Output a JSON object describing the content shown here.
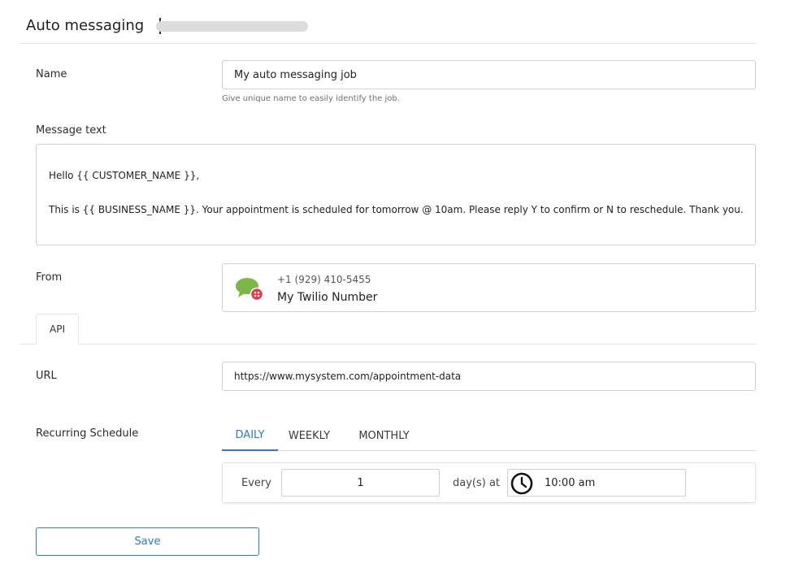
{
  "header": {
    "title": "Auto messaging"
  },
  "name_field": {
    "label": "Name",
    "value": "My auto messaging job",
    "hint": "Give unique name to easily identify the job."
  },
  "message": {
    "label": "Message text",
    "lines": [
      "Hello {{ CUSTOMER_NAME }},",
      "This is {{ BUSINESS_NAME }}. Your appointment is scheduled for tomorrow @ 10am. Please reply Y to confirm or N to reschedule. Thank you."
    ]
  },
  "from": {
    "label": "From",
    "phone": "+1 (929) 410-5455",
    "name": "My Twilio Number",
    "icon": "twilio-sms-icon"
  },
  "api_tab": {
    "label": "API"
  },
  "url_field": {
    "label": "URL",
    "value": "https://www.mysystem.com/appointment-data"
  },
  "schedule": {
    "label": "Recurring Schedule",
    "tabs": [
      "DAILY",
      "WEEKLY",
      "MONTHLY"
    ],
    "active_tab": "DAILY",
    "every_label": "Every",
    "every_value": "1",
    "unit_label": "day(s) at",
    "time_value": "10:00 am"
  },
  "actions": {
    "save_label": "Save"
  },
  "colors": {
    "accent": "#2b79d6",
    "twilio_green": "#7ab648",
    "twilio_red": "#e8354b"
  }
}
